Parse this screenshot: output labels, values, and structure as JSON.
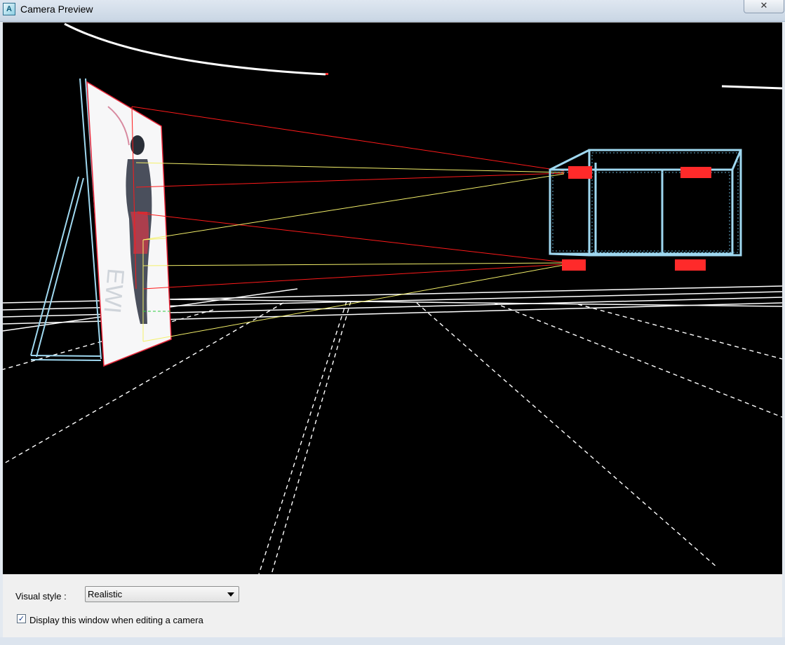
{
  "window": {
    "title": "Camera Preview",
    "app_icon": "autocad-app-icon",
    "close_glyph": "✕"
  },
  "viewport": {
    "scene": "3d-camera-preview",
    "background": "#000000",
    "colors": {
      "ground_lines": "#ffffff",
      "screen_frame": "#e8283a",
      "projector_rays_red": "#ff1a1a",
      "projector_rays_yellow": "#f4f06a",
      "truss": "#9fd8f0",
      "projectors": "#ff2a2a"
    }
  },
  "controls": {
    "visual_style_label": "Visual style :",
    "visual_style_value": "Realistic",
    "display_checkbox_checked": true,
    "display_checkbox_label": "Display this window when editing a camera",
    "check_glyph": "✓"
  }
}
